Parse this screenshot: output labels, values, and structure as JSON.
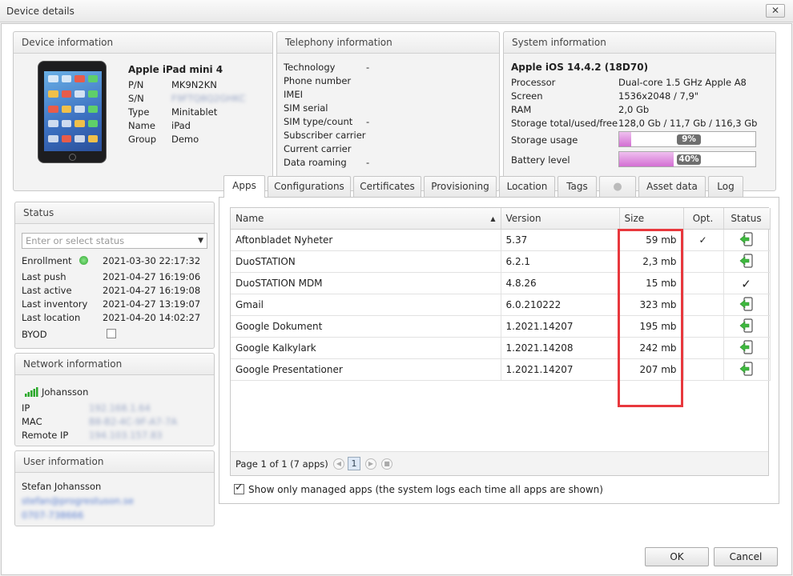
{
  "window": {
    "title": "Device details",
    "close_glyph": "✕"
  },
  "device": {
    "header": "Device information",
    "model": "Apple iPad mini 4",
    "rows": [
      {
        "label": "P/N",
        "value": "MK9N2KN"
      },
      {
        "label": "S/N",
        "value": "F9FTQ8Q2GHKC"
      },
      {
        "label": "Type",
        "value": "Minitablet"
      },
      {
        "label": "Name",
        "value": "iPad"
      },
      {
        "label": "Group",
        "value": "Demo"
      }
    ]
  },
  "telephony": {
    "header": "Telephony information",
    "rows": [
      {
        "label": "Technology",
        "value": "-"
      },
      {
        "label": "Phone number",
        "value": ""
      },
      {
        "label": "IMEI",
        "value": ""
      },
      {
        "label": "SIM serial",
        "value": ""
      },
      {
        "label": "SIM type/count",
        "value": "-"
      },
      {
        "label": "Subscriber carrier",
        "value": ""
      },
      {
        "label": "Current carrier",
        "value": ""
      },
      {
        "label": "Data roaming",
        "value": "-"
      }
    ]
  },
  "system": {
    "header": "System information",
    "os": "Apple iOS 14.4.2 (18D70)",
    "rows": [
      {
        "label": "Processor",
        "value": "Dual-core 1.5 GHz Apple A8"
      },
      {
        "label": "Screen",
        "value": "1536x2048 / 7,9\""
      },
      {
        "label": "RAM",
        "value": "2,0 Gb"
      },
      {
        "label": "Storage total/used/free",
        "value": "128,0 Gb / 11,7 Gb / 116,3 Gb"
      }
    ],
    "storage_label": "Storage usage",
    "storage_pct": 9,
    "storage_text": "9%",
    "battery_label": "Battery level",
    "battery_pct": 40,
    "battery_text": "40%"
  },
  "status": {
    "header": "Status",
    "select_placeholder": "Enter or select status",
    "rows": [
      {
        "label": "Enrollment",
        "value": "2021-03-30 22:17:32"
      },
      {
        "label": "Last push",
        "value": "2021-04-27 16:19:06"
      },
      {
        "label": "Last active",
        "value": "2021-04-27 16:19:08"
      },
      {
        "label": "Last inventory",
        "value": "2021-04-27 13:19:07"
      },
      {
        "label": "Last location",
        "value": "2021-04-20 14:02:27"
      }
    ],
    "byod_label": "BYOD"
  },
  "network": {
    "header": "Network information",
    "wifi_name": "Johansson",
    "rows": [
      {
        "label": "IP",
        "value": "192.168.1.64"
      },
      {
        "label": "MAC",
        "value": "B8-B2-4C-9F-A7-7A"
      },
      {
        "label": "Remote IP",
        "value": "194.103.157.83"
      }
    ]
  },
  "user": {
    "header": "User information",
    "name": "Stefan Johansson",
    "email": "stefan@progrestuson.se",
    "phone": "0707-738666"
  },
  "tabs": [
    "Apps",
    "Configurations",
    "Certificates",
    "Provisioning",
    "Location",
    "Tags",
    "",
    "Asset data",
    "Log"
  ],
  "apps": {
    "columns": {
      "name": "Name",
      "version": "Version",
      "size": "Size",
      "opt": "Opt.",
      "status": "Status"
    },
    "rows": [
      {
        "name": "Aftonbladet Nyheter",
        "version": "5.37",
        "size": "59 mb",
        "opt": "✓",
        "status": "install-icon"
      },
      {
        "name": "DuoSTATION",
        "version": "6.2.1",
        "size": "2,3 mb",
        "opt": "",
        "status": "install-icon"
      },
      {
        "name": "DuoSTATION MDM",
        "version": "4.8.26",
        "size": "15 mb",
        "opt": "",
        "status": "check-icon"
      },
      {
        "name": "Gmail",
        "version": "6.0.210222",
        "size": "323 mb",
        "opt": "",
        "status": "install-icon"
      },
      {
        "name": "Google Dokument",
        "version": "1.2021.14207",
        "size": "195 mb",
        "opt": "",
        "status": "install-icon"
      },
      {
        "name": "Google Kalkylark",
        "version": "1.2021.14208",
        "size": "242 mb",
        "opt": "",
        "status": "install-icon"
      },
      {
        "name": "Google Presentationer",
        "version": "1.2021.14207",
        "size": "207 mb",
        "opt": "",
        "status": "install-icon"
      }
    ],
    "pager_text": "Page 1 of 1 (7 apps)",
    "current_page": "1",
    "managed_only_label": "Show only managed apps (the system logs each time all apps are shown)"
  },
  "buttons": {
    "ok": "OK",
    "cancel": "Cancel"
  }
}
